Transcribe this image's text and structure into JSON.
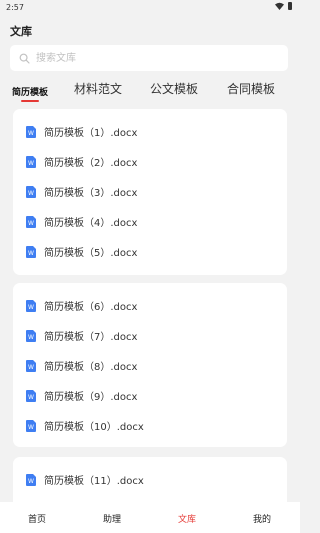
{
  "status_bar": {
    "time": "2:57"
  },
  "header": {
    "title": "文库"
  },
  "search": {
    "placeholder": "搜索文库"
  },
  "tabs": [
    {
      "label": "简历模板",
      "active": true
    },
    {
      "label": "材料范文",
      "active": false
    },
    {
      "label": "公文模板",
      "active": false
    },
    {
      "label": "合同模板",
      "active": false
    }
  ],
  "groups": [
    {
      "files": [
        "简历模板（1）.docx",
        "简历模板（2）.docx",
        "简历模板（3）.docx",
        "简历模板（4）.docx",
        "简历模板（5）.docx"
      ]
    },
    {
      "files": [
        "简历模板（6）.docx",
        "简历模板（7）.docx",
        "简历模板（8）.docx",
        "简历模板（9）.docx",
        "简历模板（10）.docx"
      ]
    },
    {
      "files": [
        "简历模板（11）.docx"
      ]
    }
  ],
  "bottom_nav": [
    {
      "label": "首页",
      "active": false
    },
    {
      "label": "助理",
      "active": false
    },
    {
      "label": "文库",
      "active": true
    },
    {
      "label": "我的",
      "active": false
    }
  ],
  "colors": {
    "accent": "#e53935",
    "doc_icon": "#3f7ef2",
    "background": "#f2f2f2"
  },
  "icons": {
    "search": "search-icon",
    "document": "word-document-icon"
  }
}
